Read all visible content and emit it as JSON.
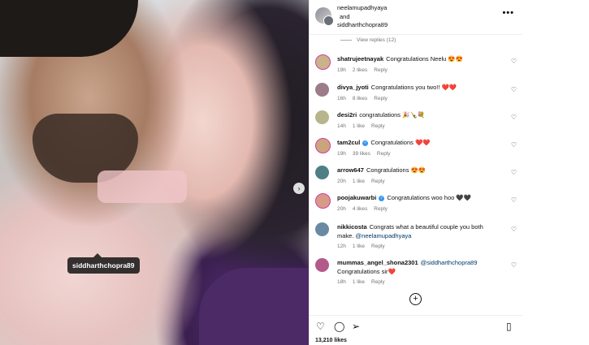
{
  "header": {
    "user1": "neelamupadhyaya",
    "conjunction": "and",
    "user2": "siddharthchopra89",
    "more_icon": "more-horizontal-icon"
  },
  "photo": {
    "tag": "siddharthchopra89",
    "next_icon": "chevron-right-icon"
  },
  "view_replies": "View replies (12)",
  "comments": [
    {
      "user": "shatrujeetnayak",
      "text": "Congratulations Neelu 😍😍",
      "time": "19h",
      "likes": "2 likes",
      "reply": "Reply",
      "avatar": "#c9b48a"
    },
    {
      "user": "divya_jyoti",
      "text": "Congratulations you two!! ❤️❤️",
      "time": "16h",
      "likes": "8 likes",
      "reply": "Reply",
      "avatar": "#9d7c8a"
    },
    {
      "user": "desi2ri",
      "text": "congratulations 🎉🍾💐",
      "time": "14h",
      "likes": "1 like",
      "reply": "Reply",
      "avatar": "#b8b58c"
    },
    {
      "user": "tam2cul",
      "text": "Congratulations ❤️❤️",
      "time": "19h",
      "likes": "39 likes",
      "reply": "Reply",
      "avatar": "#caa57c",
      "verified": true
    },
    {
      "user": "arrow647",
      "text": "Congratulations 😍😍",
      "time": "20h",
      "likes": "1 like",
      "reply": "Reply",
      "avatar": "#4e7f86"
    },
    {
      "user": "poojakuwarbi",
      "text": "Congratulations woo hoo 🖤🖤",
      "time": "20h",
      "likes": "4 likes",
      "reply": "Reply",
      "avatar": "#d79a86",
      "verified": true
    },
    {
      "user": "nikkicosta",
      "text": "Congrats what a beautiful couple you both make.",
      "mention": "@neelamupadhyaya",
      "time": "12h",
      "likes": "1 like",
      "reply": "Reply",
      "avatar": "#6a8aa3"
    },
    {
      "user": "mummas_angel_shona2301",
      "mention": "@siddharthchopra89",
      "text": "Congratulations sir❤️",
      "time": "18h",
      "likes": "1 like",
      "reply": "Reply",
      "avatar": "#b35a8a"
    }
  ],
  "add_icon": "add-circle-icon",
  "actions": {
    "like_icon": "heart-icon",
    "comment_icon": "comment-icon",
    "share_icon": "share-icon",
    "save_icon": "bookmark-icon"
  },
  "likes_count": "13,210 likes"
}
